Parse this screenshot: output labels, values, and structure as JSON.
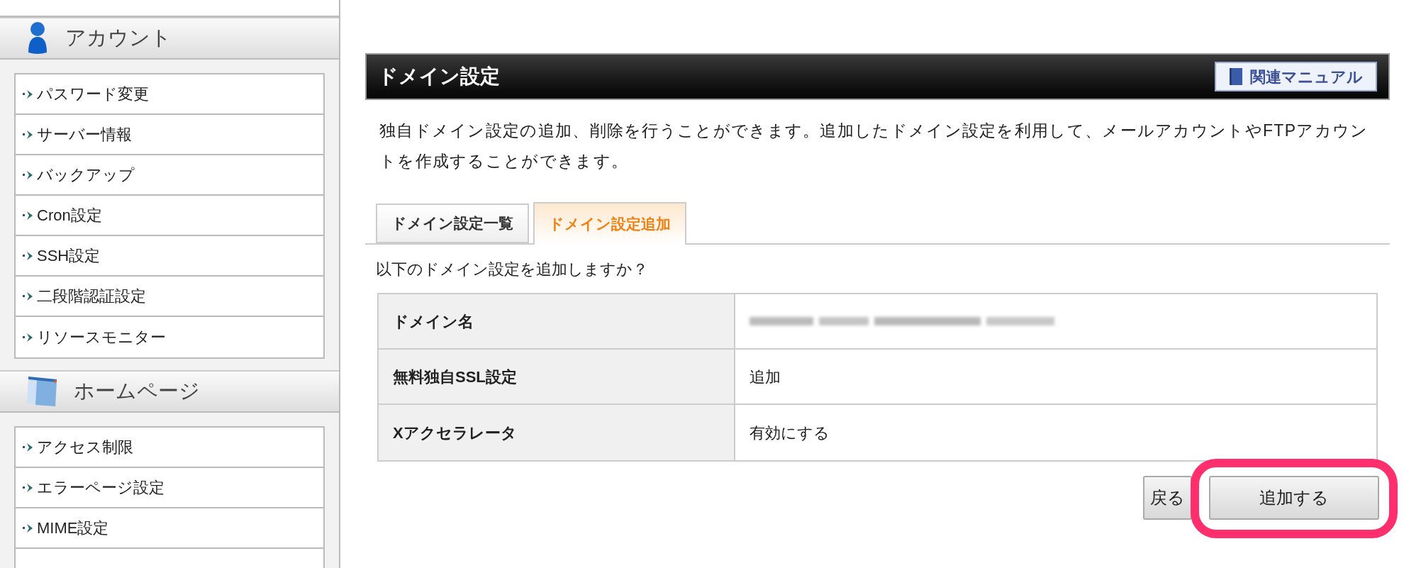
{
  "sidebar": {
    "sections": [
      {
        "kind": "account",
        "title": "アカウント",
        "items": [
          "パスワード変更",
          "サーバー情報",
          "バックアップ",
          "Cron設定",
          "SSH設定",
          "二段階認証設定",
          "リソースモニター"
        ]
      },
      {
        "kind": "homepage",
        "title": "ホームページ",
        "items": [
          "アクセス制限",
          "エラーページ設定",
          "MIME設定"
        ]
      }
    ]
  },
  "page": {
    "title": "ドメイン設定",
    "manual_button": "関連マニュアル",
    "description": "独自ドメイン設定の追加、削除を行うことができます。追加したドメイン設定を利用して、メールアカウントやFTPアカウントを作成することができます。",
    "tabs": [
      {
        "label": "ドメイン設定一覧",
        "selected": false
      },
      {
        "label": "ドメイン設定追加",
        "selected": true
      }
    ],
    "question": "以下のドメイン設定を追加しますか？",
    "table": {
      "rows": [
        {
          "label": "ドメイン名",
          "kind": "redacted"
        },
        {
          "label": "無料独自SSL設定",
          "kind": "text",
          "value": "追加"
        },
        {
          "label": "Xアクセラレータ",
          "kind": "text",
          "value": "有効にする"
        }
      ]
    },
    "buttons": [
      {
        "label": "戻る",
        "highlighted": false
      },
      {
        "label": "追加する",
        "highlighted": true
      }
    ]
  }
}
